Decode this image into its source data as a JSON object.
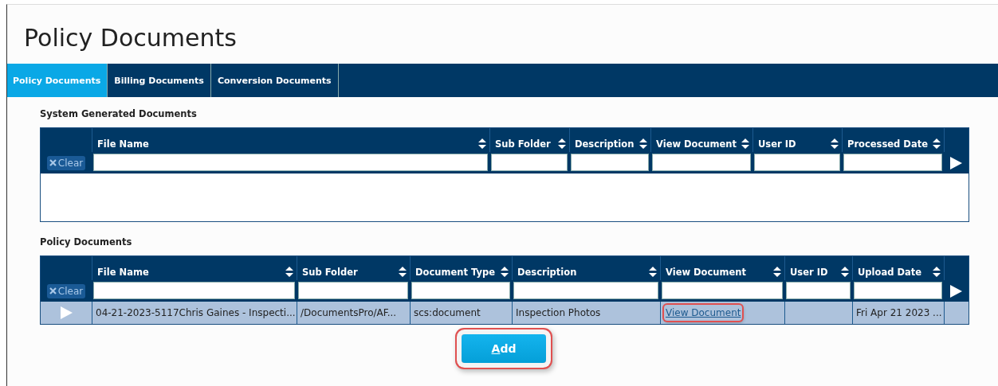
{
  "title": "Policy Documents",
  "tabs": [
    {
      "label": "Policy Documents",
      "selected": true
    },
    {
      "label": "Billing Documents",
      "selected": false
    },
    {
      "label": "Conversion Documents",
      "selected": false
    }
  ],
  "sections": [
    {
      "heading": "System Generated Documents",
      "clear_label": "Clear",
      "columns": [
        "File Name",
        "Sub Folder",
        "Description",
        "View Document",
        "User ID",
        "Processed Date"
      ]
    },
    {
      "heading": "Policy Documents",
      "clear_label": "Clear",
      "columns": [
        "File Name",
        "Sub Folder",
        "Document Type",
        "Description",
        "View Document",
        "User ID",
        "Upload Date"
      ],
      "rows": [
        {
          "cells": [
            {
              "kind": "text",
              "text": "04-21-2023-5117Chris Gaines - Inspecti..."
            },
            {
              "kind": "text",
              "text": "/DocumentsPro/AF..."
            },
            {
              "kind": "text",
              "text": "scs:document"
            },
            {
              "kind": "text",
              "text": "Inspection Photos"
            },
            {
              "kind": "link",
              "text": "View Document",
              "highlighted": true
            },
            {
              "kind": "empty"
            },
            {
              "kind": "text",
              "text": "Fri Apr 21 2023 ..."
            }
          ]
        }
      ]
    }
  ],
  "add_button": {
    "label": "Add",
    "highlighted": true
  }
}
